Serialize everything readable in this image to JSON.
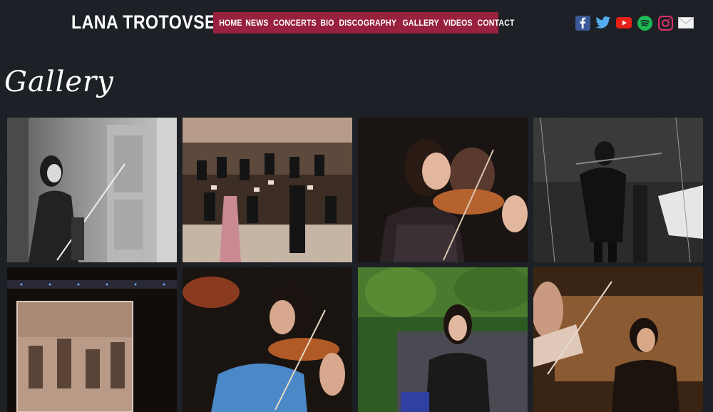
{
  "header": {
    "site_title": "LANA TROTOVSEK",
    "nav": [
      "HOME",
      "NEWS",
      "CONCERTS",
      "BIO",
      "DISCOGRAPHY",
      "GALLERY",
      "VIDEOS",
      "CONTACT"
    ],
    "social_icons": [
      "facebook-icon",
      "twitter-icon",
      "youtube-icon",
      "spotify-icon",
      "instagram-icon",
      "mail-icon"
    ]
  },
  "main": {
    "heading": "Gallery",
    "photos": [
      "violinist-bw-hall",
      "orchestra-stage",
      "violinist-black-dress",
      "violinist-bw-stage",
      "concert-screen",
      "violinist-blue-dress",
      "violinist-outdoor",
      "violinist-warm-light"
    ]
  },
  "colors": {
    "background": "#1b1e24",
    "nav": "#98213e",
    "text": "#ffffff"
  }
}
